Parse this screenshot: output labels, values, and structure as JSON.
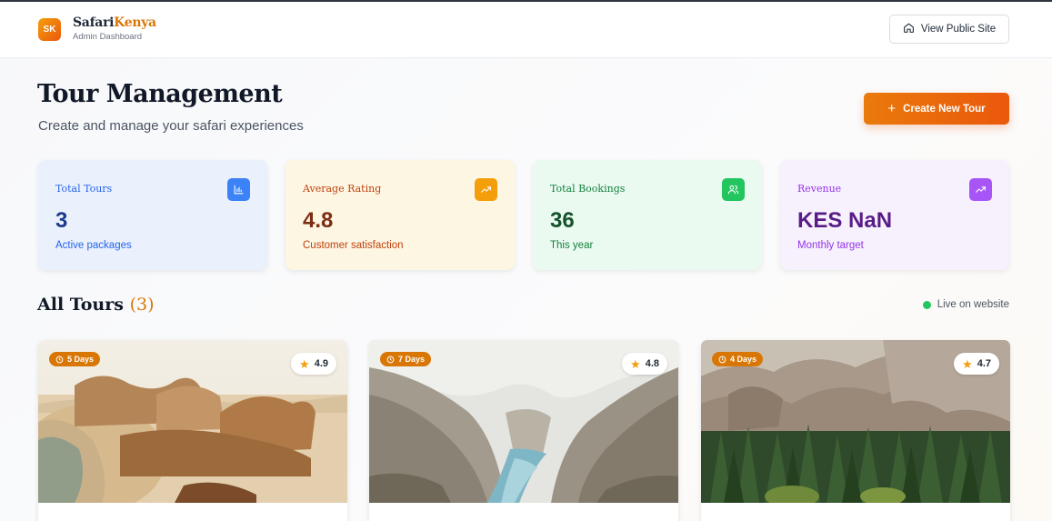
{
  "header": {
    "logo_text": "SK",
    "brand_main": "Safari",
    "brand_accent": "Kenya",
    "brand_sub": "Admin Dashboard",
    "view_public_label": "View Public Site",
    "view_public_icon": "home-icon"
  },
  "page": {
    "title": "Tour Management",
    "subtitle": "Create and manage your safari experiences",
    "create_label": "Create New Tour",
    "create_icon": "+"
  },
  "stats": [
    {
      "label": "Total Tours",
      "value": "3",
      "note": "Active packages",
      "icon": "bar-chart-icon",
      "color": "#3b82f6"
    },
    {
      "label": "Average Rating",
      "value": "4.8",
      "note": "Customer satisfaction",
      "icon": "trending-up-icon",
      "color": "#f59e0b"
    },
    {
      "label": "Total Bookings",
      "value": "36",
      "note": "This year",
      "icon": "users-icon",
      "color": "#22c55e"
    },
    {
      "label": "Revenue",
      "value": "KES NaN",
      "note": "Monthly target",
      "icon": "trending-up-icon",
      "color": "#a855f7"
    }
  ],
  "tours_section": {
    "title": "All Tours",
    "count": "(3)",
    "live_label": "Live on website",
    "live_color": "#22c55e"
  },
  "tours": [
    {
      "duration": "5 Days",
      "rating": "4.9",
      "image": "camels-desert"
    },
    {
      "duration": "7 Days",
      "rating": "4.8",
      "image": "canyon-river"
    },
    {
      "duration": "4 Days",
      "rating": "4.7",
      "image": "mountain-forest"
    }
  ]
}
